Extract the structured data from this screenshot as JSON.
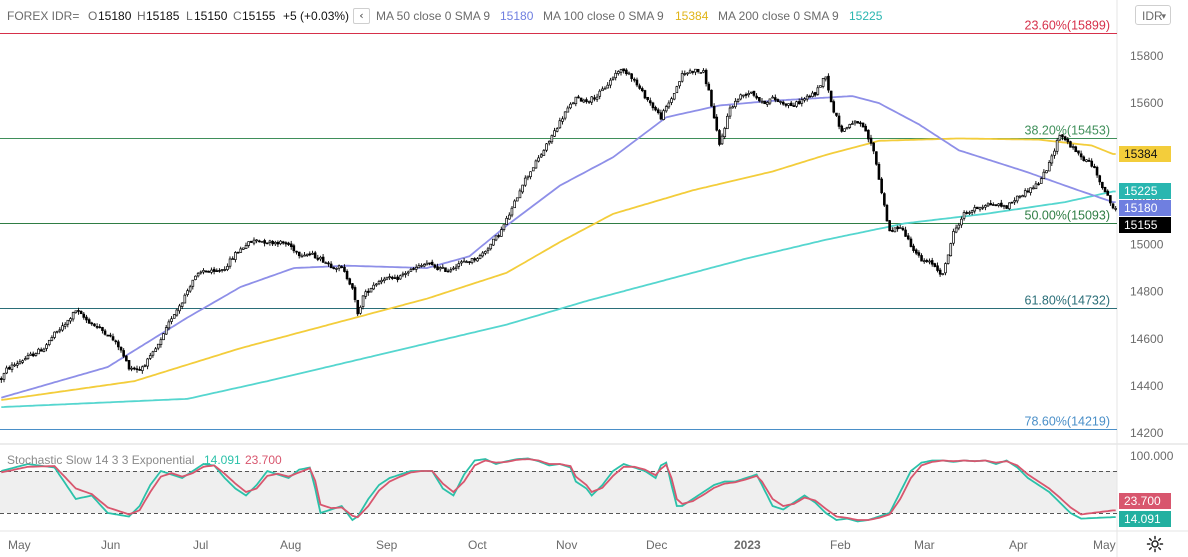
{
  "header": {
    "symbol": "FOREX IDR=",
    "open_key": "O",
    "open": "15180",
    "high_key": "H",
    "high": "15185",
    "low_key": "L",
    "low": "15150",
    "close_key": "C",
    "close": "15155",
    "change": "+5 (+0.03%)",
    "ma50_label": "MA 50 close 0 SMA 9",
    "ma50_value": "15180",
    "ma100_label": "MA 100 close 0 SMA 9",
    "ma100_value": "15384",
    "ma200_label": "MA 200 close 0 SMA 9",
    "ma200_value": "15225",
    "symbol_button": "IDR",
    "collapse_icon": "chevron-left-icon"
  },
  "colors": {
    "ma50": "#8e8fe8",
    "ma100": "#f3cd3b",
    "ma200": "#55d6cf",
    "fib_23": "#d6304a",
    "fib_38": "#3f8f5a",
    "fib_50": "#2f7d44",
    "fib_61": "#2a6e78",
    "fib_78": "#4a8fc8",
    "stoch_k": "#2bc1a9",
    "stoch_d": "#d8566e",
    "candle": "#000000"
  },
  "fib_levels": [
    {
      "label": "23.60%(15899)",
      "value": 15899,
      "color_key": "fib_23"
    },
    {
      "label": "38.20%(15453)",
      "value": 15453,
      "color_key": "fib_38"
    },
    {
      "label": "50.00%(15093)",
      "value": 15093,
      "color_key": "fib_50"
    },
    {
      "label": "61.80%(14732)",
      "value": 14732,
      "color_key": "fib_61"
    },
    {
      "label": "78.60%(14219)",
      "value": 14219,
      "color_key": "fib_78"
    }
  ],
  "price_tags": [
    {
      "text": "15384",
      "value": 15384,
      "bg": "#f3cd3b",
      "dark": true
    },
    {
      "text": "15225",
      "value": 15225,
      "bg": "#29b6b0",
      "dark": false
    },
    {
      "text": "15180",
      "value": 15180,
      "bg": "#6f7fe0",
      "dark": false
    },
    {
      "text": "15155",
      "value": 15155,
      "bg": "#000000",
      "dark": false
    }
  ],
  "stochastic": {
    "label": "Stochastic Slow 14 3 3 Exponential",
    "k_value": "14.091",
    "d_value": "23.700",
    "upper_level": 80,
    "lower_level": 20,
    "upper_label": "100.000",
    "y_range": [
      0,
      100
    ]
  },
  "chart_data": {
    "type": "candlestick",
    "y_axis": {
      "ticks": [
        14200,
        14400,
        14600,
        14800,
        15000,
        15200,
        15400,
        15600,
        15800
      ],
      "range": [
        14195,
        15955
      ]
    },
    "x_axis": {
      "labels": [
        "May",
        "Jun",
        "Jul",
        "Aug",
        "Sep",
        "Oct",
        "Nov",
        "Dec",
        "2023",
        "Feb",
        "Mar",
        "Apr",
        "May"
      ],
      "bold_label": "2023"
    },
    "price_keypoints": [
      [
        0,
        14430
      ],
      [
        2,
        14470
      ],
      [
        8,
        14510
      ],
      [
        16,
        14560
      ],
      [
        20,
        14620
      ],
      [
        24,
        14660
      ],
      [
        28,
        14720
      ],
      [
        32,
        14680
      ],
      [
        36,
        14650
      ],
      [
        40,
        14620
      ],
      [
        44,
        14570
      ],
      [
        48,
        14480
      ],
      [
        52,
        14470
      ],
      [
        56,
        14520
      ],
      [
        60,
        14590
      ],
      [
        64,
        14690
      ],
      [
        68,
        14760
      ],
      [
        72,
        14850
      ],
      [
        76,
        14890
      ],
      [
        80,
        14880
      ],
      [
        84,
        14900
      ],
      [
        88,
        14960
      ],
      [
        92,
        15000
      ],
      [
        96,
        15020
      ],
      [
        100,
        15010
      ],
      [
        104,
        15010
      ],
      [
        108,
        15000
      ],
      [
        112,
        14960
      ],
      [
        116,
        14960
      ],
      [
        120,
        14940
      ],
      [
        124,
        14910
      ],
      [
        128,
        14900
      ],
      [
        132,
        14820
      ],
      [
        134,
        14700
      ],
      [
        136,
        14780
      ],
      [
        140,
        14830
      ],
      [
        144,
        14860
      ],
      [
        148,
        14850
      ],
      [
        152,
        14880
      ],
      [
        156,
        14900
      ],
      [
        160,
        14920
      ],
      [
        164,
        14900
      ],
      [
        168,
        14890
      ],
      [
        172,
        14920
      ],
      [
        176,
        14930
      ],
      [
        180,
        14950
      ],
      [
        184,
        15000
      ],
      [
        188,
        15060
      ],
      [
        192,
        15150
      ],
      [
        196,
        15260
      ],
      [
        200,
        15330
      ],
      [
        204,
        15400
      ],
      [
        208,
        15480
      ],
      [
        212,
        15560
      ],
      [
        216,
        15620
      ],
      [
        220,
        15610
      ],
      [
        224,
        15630
      ],
      [
        228,
        15680
      ],
      [
        232,
        15740
      ],
      [
        236,
        15730
      ],
      [
        240,
        15660
      ],
      [
        244,
        15600
      ],
      [
        248,
        15540
      ],
      [
        252,
        15620
      ],
      [
        256,
        15720
      ],
      [
        260,
        15740
      ],
      [
        264,
        15730
      ],
      [
        266,
        15650
      ],
      [
        270,
        15420
      ],
      [
        274,
        15580
      ],
      [
        278,
        15630
      ],
      [
        282,
        15650
      ],
      [
        286,
        15600
      ],
      [
        290,
        15620
      ],
      [
        294,
        15600
      ],
      [
        298,
        15590
      ],
      [
        302,
        15620
      ],
      [
        306,
        15640
      ],
      [
        310,
        15720
      ],
      [
        312,
        15600
      ],
      [
        316,
        15480
      ],
      [
        320,
        15520
      ],
      [
        324,
        15500
      ],
      [
        328,
        15400
      ],
      [
        330,
        15280
      ],
      [
        334,
        15050
      ],
      [
        338,
        15080
      ],
      [
        342,
        15000
      ],
      [
        346,
        14930
      ],
      [
        350,
        14920
      ],
      [
        354,
        14870
      ],
      [
        358,
        15050
      ],
      [
        362,
        15130
      ],
      [
        366,
        15150
      ],
      [
        370,
        15170
      ],
      [
        374,
        15170
      ],
      [
        378,
        15160
      ],
      [
        382,
        15200
      ],
      [
        386,
        15230
      ],
      [
        390,
        15260
      ],
      [
        394,
        15340
      ],
      [
        398,
        15470
      ],
      [
        402,
        15420
      ],
      [
        406,
        15370
      ],
      [
        410,
        15340
      ],
      [
        414,
        15250
      ],
      [
        418,
        15155
      ]
    ],
    "ma50_keypoints": [
      [
        0,
        14350
      ],
      [
        40,
        14480
      ],
      [
        70,
        14690
      ],
      [
        90,
        14820
      ],
      [
        110,
        14900
      ],
      [
        130,
        14910
      ],
      [
        160,
        14900
      ],
      [
        176,
        14950
      ],
      [
        190,
        15080
      ],
      [
        210,
        15250
      ],
      [
        230,
        15370
      ],
      [
        250,
        15540
      ],
      [
        270,
        15590
      ],
      [
        290,
        15610
      ],
      [
        320,
        15630
      ],
      [
        330,
        15600
      ],
      [
        345,
        15510
      ],
      [
        360,
        15400
      ],
      [
        385,
        15310
      ],
      [
        405,
        15230
      ],
      [
        418,
        15180
      ]
    ],
    "ma100_keypoints": [
      [
        0,
        14340
      ],
      [
        50,
        14420
      ],
      [
        90,
        14560
      ],
      [
        130,
        14680
      ],
      [
        160,
        14770
      ],
      [
        190,
        14880
      ],
      [
        210,
        15010
      ],
      [
        230,
        15130
      ],
      [
        260,
        15230
      ],
      [
        290,
        15310
      ],
      [
        310,
        15380
      ],
      [
        330,
        15440
      ],
      [
        360,
        15450
      ],
      [
        390,
        15445
      ],
      [
        410,
        15420
      ],
      [
        418,
        15384
      ]
    ],
    "ma200_keypoints": [
      [
        0,
        14310
      ],
      [
        40,
        14330
      ],
      [
        70,
        14345
      ],
      [
        100,
        14420
      ],
      [
        130,
        14500
      ],
      [
        160,
        14580
      ],
      [
        190,
        14660
      ],
      [
        220,
        14760
      ],
      [
        250,
        14850
      ],
      [
        280,
        14940
      ],
      [
        310,
        15020
      ],
      [
        340,
        15090
      ],
      [
        370,
        15130
      ],
      [
        400,
        15180
      ],
      [
        418,
        15225
      ]
    ],
    "stoch_k_keypoints": [
      [
        0,
        80
      ],
      [
        10,
        90
      ],
      [
        20,
        85
      ],
      [
        28,
        40
      ],
      [
        34,
        45
      ],
      [
        40,
        20
      ],
      [
        48,
        15
      ],
      [
        52,
        30
      ],
      [
        56,
        60
      ],
      [
        60,
        80
      ],
      [
        64,
        75
      ],
      [
        68,
        70
      ],
      [
        72,
        80
      ],
      [
        76,
        90
      ],
      [
        80,
        88
      ],
      [
        84,
        70
      ],
      [
        88,
        55
      ],
      [
        92,
        45
      ],
      [
        96,
        60
      ],
      [
        100,
        80
      ],
      [
        104,
        75
      ],
      [
        108,
        70
      ],
      [
        112,
        82
      ],
      [
        116,
        85
      ],
      [
        118,
        55
      ],
      [
        120,
        20
      ],
      [
        124,
        25
      ],
      [
        128,
        30
      ],
      [
        132,
        10
      ],
      [
        134,
        15
      ],
      [
        138,
        40
      ],
      [
        142,
        60
      ],
      [
        146,
        70
      ],
      [
        150,
        75
      ],
      [
        154,
        80
      ],
      [
        158,
        80
      ],
      [
        162,
        80
      ],
      [
        166,
        55
      ],
      [
        170,
        45
      ],
      [
        174,
        75
      ],
      [
        178,
        95
      ],
      [
        182,
        97
      ],
      [
        186,
        90
      ],
      [
        190,
        94
      ],
      [
        194,
        97
      ],
      [
        198,
        98
      ],
      [
        202,
        94
      ],
      [
        206,
        88
      ],
      [
        210,
        90
      ],
      [
        214,
        85
      ],
      [
        216,
        65
      ],
      [
        220,
        55
      ],
      [
        222,
        45
      ],
      [
        226,
        60
      ],
      [
        230,
        80
      ],
      [
        234,
        90
      ],
      [
        238,
        85
      ],
      [
        242,
        80
      ],
      [
        246,
        70
      ],
      [
        248,
        88
      ],
      [
        250,
        92
      ],
      [
        252,
        60
      ],
      [
        254,
        30
      ],
      [
        256,
        30
      ],
      [
        260,
        40
      ],
      [
        264,
        50
      ],
      [
        268,
        60
      ],
      [
        272,
        65
      ],
      [
        276,
        65
      ],
      [
        280,
        70
      ],
      [
        284,
        75
      ],
      [
        286,
        60
      ],
      [
        290,
        30
      ],
      [
        294,
        25
      ],
      [
        298,
        35
      ],
      [
        302,
        45
      ],
      [
        306,
        35
      ],
      [
        310,
        20
      ],
      [
        314,
        10
      ],
      [
        318,
        12
      ],
      [
        322,
        8
      ],
      [
        326,
        10
      ],
      [
        330,
        15
      ],
      [
        334,
        20
      ],
      [
        338,
        50
      ],
      [
        342,
        80
      ],
      [
        346,
        92
      ],
      [
        350,
        95
      ],
      [
        354,
        95
      ],
      [
        358,
        93
      ],
      [
        362,
        95
      ],
      [
        366,
        94
      ],
      [
        370,
        95
      ],
      [
        374,
        90
      ],
      [
        378,
        95
      ],
      [
        382,
        85
      ],
      [
        386,
        70
      ],
      [
        390,
        60
      ],
      [
        394,
        50
      ],
      [
        398,
        35
      ],
      [
        402,
        20
      ],
      [
        406,
        12
      ],
      [
        418,
        14.091
      ]
    ],
    "stoch_d_keypoints": [
      [
        0,
        78
      ],
      [
        10,
        86
      ],
      [
        20,
        87
      ],
      [
        28,
        55
      ],
      [
        34,
        47
      ],
      [
        40,
        28
      ],
      [
        48,
        18
      ],
      [
        52,
        24
      ],
      [
        56,
        50
      ],
      [
        60,
        72
      ],
      [
        64,
        77
      ],
      [
        68,
        72
      ],
      [
        72,
        77
      ],
      [
        76,
        86
      ],
      [
        80,
        88
      ],
      [
        84,
        76
      ],
      [
        88,
        62
      ],
      [
        92,
        50
      ],
      [
        96,
        55
      ],
      [
        100,
        73
      ],
      [
        104,
        76
      ],
      [
        108,
        72
      ],
      [
        112,
        78
      ],
      [
        116,
        84
      ],
      [
        118,
        66
      ],
      [
        120,
        32
      ],
      [
        124,
        27
      ],
      [
        128,
        28
      ],
      [
        132,
        16
      ],
      [
        134,
        14
      ],
      [
        138,
        30
      ],
      [
        142,
        52
      ],
      [
        146,
        65
      ],
      [
        150,
        72
      ],
      [
        154,
        78
      ],
      [
        158,
        80
      ],
      [
        162,
        80
      ],
      [
        166,
        62
      ],
      [
        170,
        50
      ],
      [
        174,
        65
      ],
      [
        178,
        88
      ],
      [
        182,
        95
      ],
      [
        186,
        92
      ],
      [
        190,
        93
      ],
      [
        194,
        96
      ],
      [
        198,
        97
      ],
      [
        202,
        95
      ],
      [
        206,
        90
      ],
      [
        210,
        90
      ],
      [
        214,
        87
      ],
      [
        216,
        72
      ],
      [
        220,
        60
      ],
      [
        222,
        50
      ],
      [
        226,
        56
      ],
      [
        230,
        73
      ],
      [
        234,
        86
      ],
      [
        238,
        86
      ],
      [
        242,
        82
      ],
      [
        246,
        74
      ],
      [
        248,
        83
      ],
      [
        250,
        89
      ],
      [
        252,
        70
      ],
      [
        254,
        40
      ],
      [
        256,
        33
      ],
      [
        260,
        37
      ],
      [
        264,
        46
      ],
      [
        268,
        56
      ],
      [
        272,
        62
      ],
      [
        276,
        64
      ],
      [
        280,
        68
      ],
      [
        284,
        73
      ],
      [
        286,
        65
      ],
      [
        290,
        40
      ],
      [
        294,
        30
      ],
      [
        298,
        33
      ],
      [
        302,
        42
      ],
      [
        306,
        38
      ],
      [
        310,
        26
      ],
      [
        314,
        15
      ],
      [
        318,
        13
      ],
      [
        322,
        10
      ],
      [
        326,
        10
      ],
      [
        330,
        13
      ],
      [
        334,
        18
      ],
      [
        338,
        40
      ],
      [
        342,
        70
      ],
      [
        346,
        88
      ],
      [
        350,
        93
      ],
      [
        354,
        95
      ],
      [
        358,
        94
      ],
      [
        362,
        95
      ],
      [
        366,
        94
      ],
      [
        370,
        95
      ],
      [
        374,
        92
      ],
      [
        378,
        94
      ],
      [
        382,
        88
      ],
      [
        386,
        75
      ],
      [
        390,
        65
      ],
      [
        394,
        55
      ],
      [
        398,
        42
      ],
      [
        402,
        28
      ],
      [
        406,
        18
      ],
      [
        418,
        23.7
      ]
    ]
  }
}
